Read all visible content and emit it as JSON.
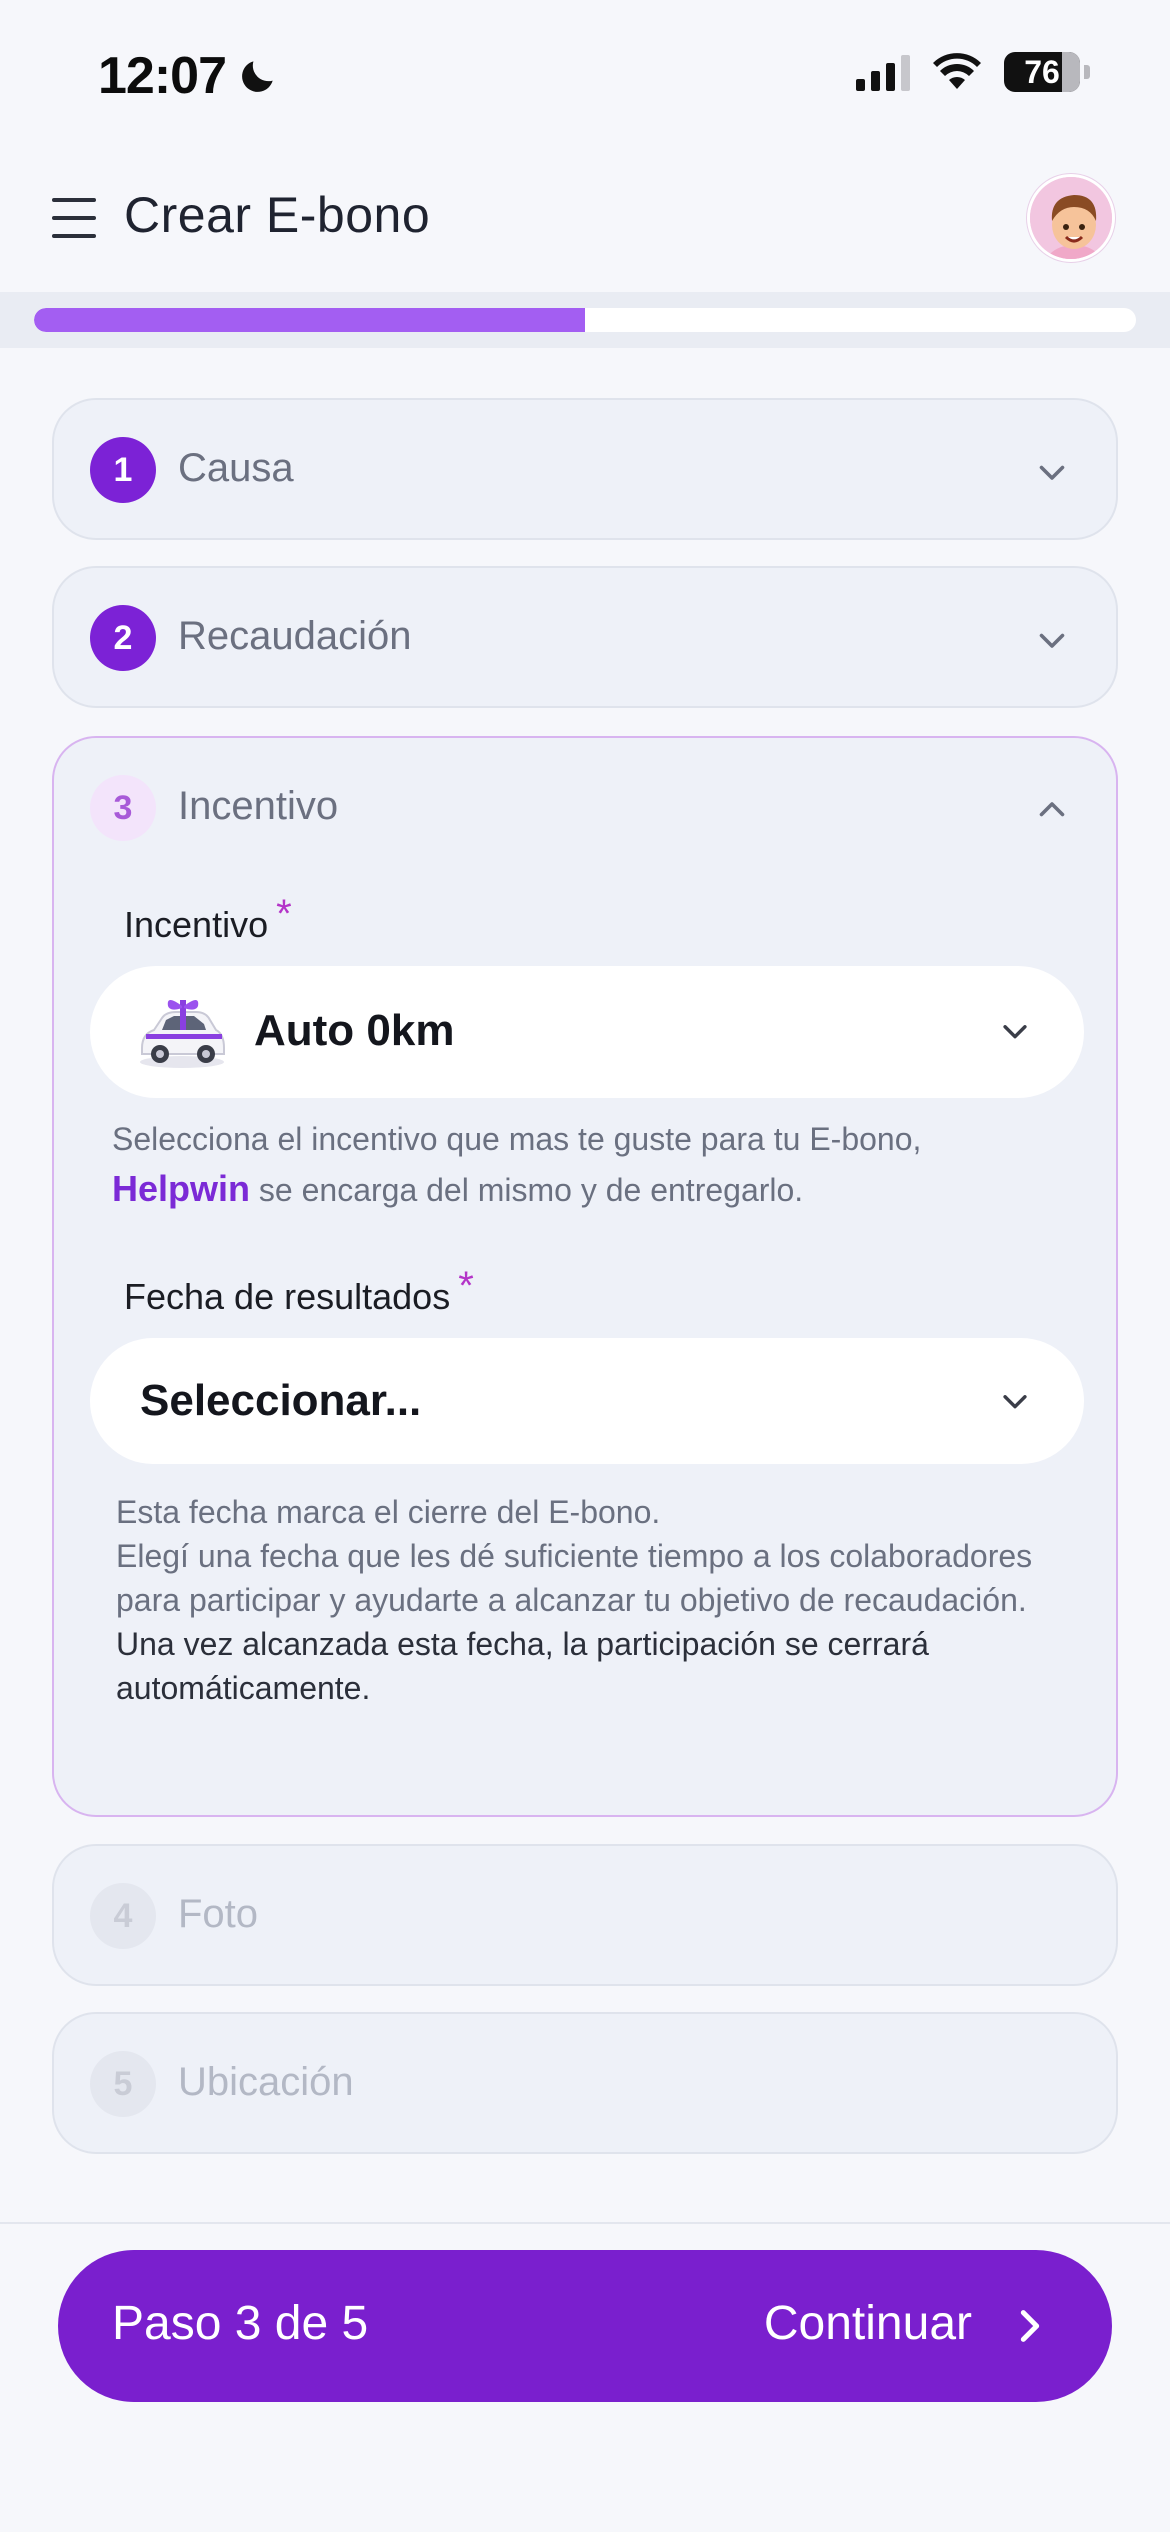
{
  "status_bar": {
    "time": "12:07",
    "battery": "76",
    "icons": [
      "moon-icon",
      "signal-icon",
      "wifi-icon",
      "battery-icon"
    ]
  },
  "header": {
    "title": "Crear E-bono",
    "menu_icon": "hamburger-menu-icon",
    "avatar_icon": "user-avatar"
  },
  "progress": {
    "value_percent": 50
  },
  "steps": [
    {
      "number": "1",
      "label": "Causa",
      "state": "completed"
    },
    {
      "number": "2",
      "label": "Recaudación",
      "state": "completed"
    },
    {
      "number": "3",
      "label": "Incentivo",
      "state": "open"
    },
    {
      "number": "4",
      "label": "Foto",
      "state": "disabled"
    },
    {
      "number": "5",
      "label": "Ubicación",
      "state": "disabled"
    }
  ],
  "incentive_section": {
    "incentive_label": "Incentivo",
    "required_mark": "*",
    "incentive_value": "Auto 0km",
    "incentive_help_1": "Selecciona el incentivo que mas te guste para tu E-bono,",
    "incentive_help_brand": "Helpwin",
    "incentive_help_2": " se encarga del mismo y de entregarlo.",
    "date_label": "Fecha de resultados",
    "date_placeholder": "Seleccionar...",
    "date_help_1": "Esta fecha marca el cierre del E-bono.",
    "date_help_2": "Elegí una fecha que les dé suficiente tiempo a los colaboradores para participar y ayudarte a alcanzar tu objetivo de recaudación.",
    "date_help_3": "Una vez alcanzada esta fecha, la participación se cerrará automáticamente."
  },
  "footer": {
    "step_text": "Paso 3 de 5",
    "continue_label": "Continuar"
  },
  "colors": {
    "primary": "#7a1fce",
    "progress": "#a35ef2",
    "accent_required": "#b434c8"
  }
}
